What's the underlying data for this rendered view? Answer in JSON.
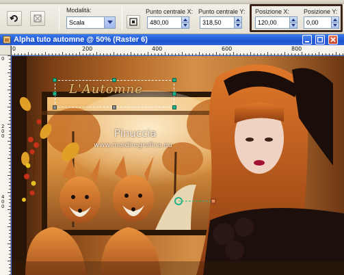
{
  "toolbar": {
    "modalita_label": "Modalità:",
    "modalita_value": "Scala",
    "punto_centrale_x_label": "Punto centrale X:",
    "punto_centrale_x_value": "480,00",
    "punto_centrale_y_label": "Punto centrale Y:",
    "punto_centrale_y_value": "318,50",
    "posizione_x_label": "Posizione X:",
    "posizione_x_value": "120,00",
    "posizione_y_label": "Posizione Y:",
    "posizione_y_value": "0,00"
  },
  "window": {
    "title": "Alpha tuto automne  @  50% (Raster 6)"
  },
  "ruler": {
    "top_labels": [
      "0",
      "200",
      "400",
      "600",
      "800"
    ],
    "left_labels": [
      "0",
      "2 0 0",
      "4 0 0"
    ]
  },
  "canvas": {
    "title_text": "L'Automne",
    "watermark_name": "Pinuccia",
    "watermark_site": "www.maidiregrafica.eu"
  },
  "colors": {
    "highlight_frame": "#3a2418",
    "handle_green": "#1fb589",
    "titlebar_blue": "#2356d1"
  }
}
